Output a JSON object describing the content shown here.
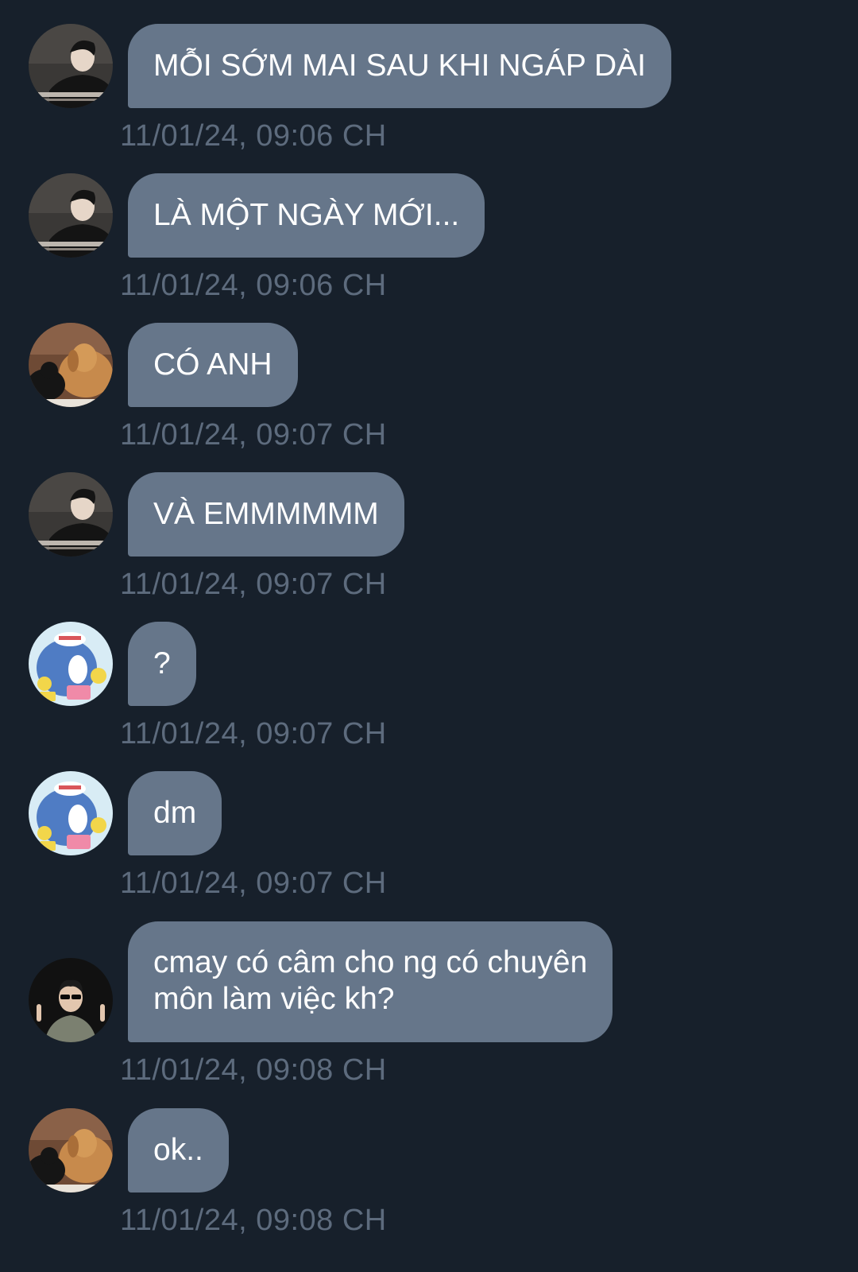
{
  "messages": [
    {
      "text": "MỖI SỚM MAI SAU KHI NGÁP DÀI",
      "time": "11/01/24, 09:06 CH",
      "avatar": "avatar-man-desk"
    },
    {
      "text": "LÀ MỘT NGÀY MỚI...",
      "time": "11/01/24, 09:06 CH",
      "avatar": "avatar-man-desk"
    },
    {
      "text": "CÓ ANH",
      "time": "11/01/24, 09:07 CH",
      "avatar": "avatar-dog-cat"
    },
    {
      "text": "VÀ EMMMMMM",
      "time": "11/01/24, 09:07 CH",
      "avatar": "avatar-man-desk"
    },
    {
      "text": "?",
      "time": "11/01/24, 09:07 CH",
      "avatar": "avatar-cartoon-penguin"
    },
    {
      "text": "dm",
      "time": "11/01/24, 09:07 CH",
      "avatar": "avatar-cartoon-penguin"
    },
    {
      "text_line1": "cmay có câm cho ng có chuyên",
      "text_line2": "môn làm việc kh?",
      "time": "11/01/24, 09:08 CH",
      "avatar": "avatar-man-sunglasses"
    },
    {
      "text": "ok..",
      "time": "11/01/24, 09:08 CH",
      "avatar": "avatar-dog-cat"
    }
  ],
  "colors": {
    "background": "#17202b",
    "bubble": "#66768a",
    "bubble_text": "#ffffff",
    "timestamp": "#5d6b7d"
  }
}
